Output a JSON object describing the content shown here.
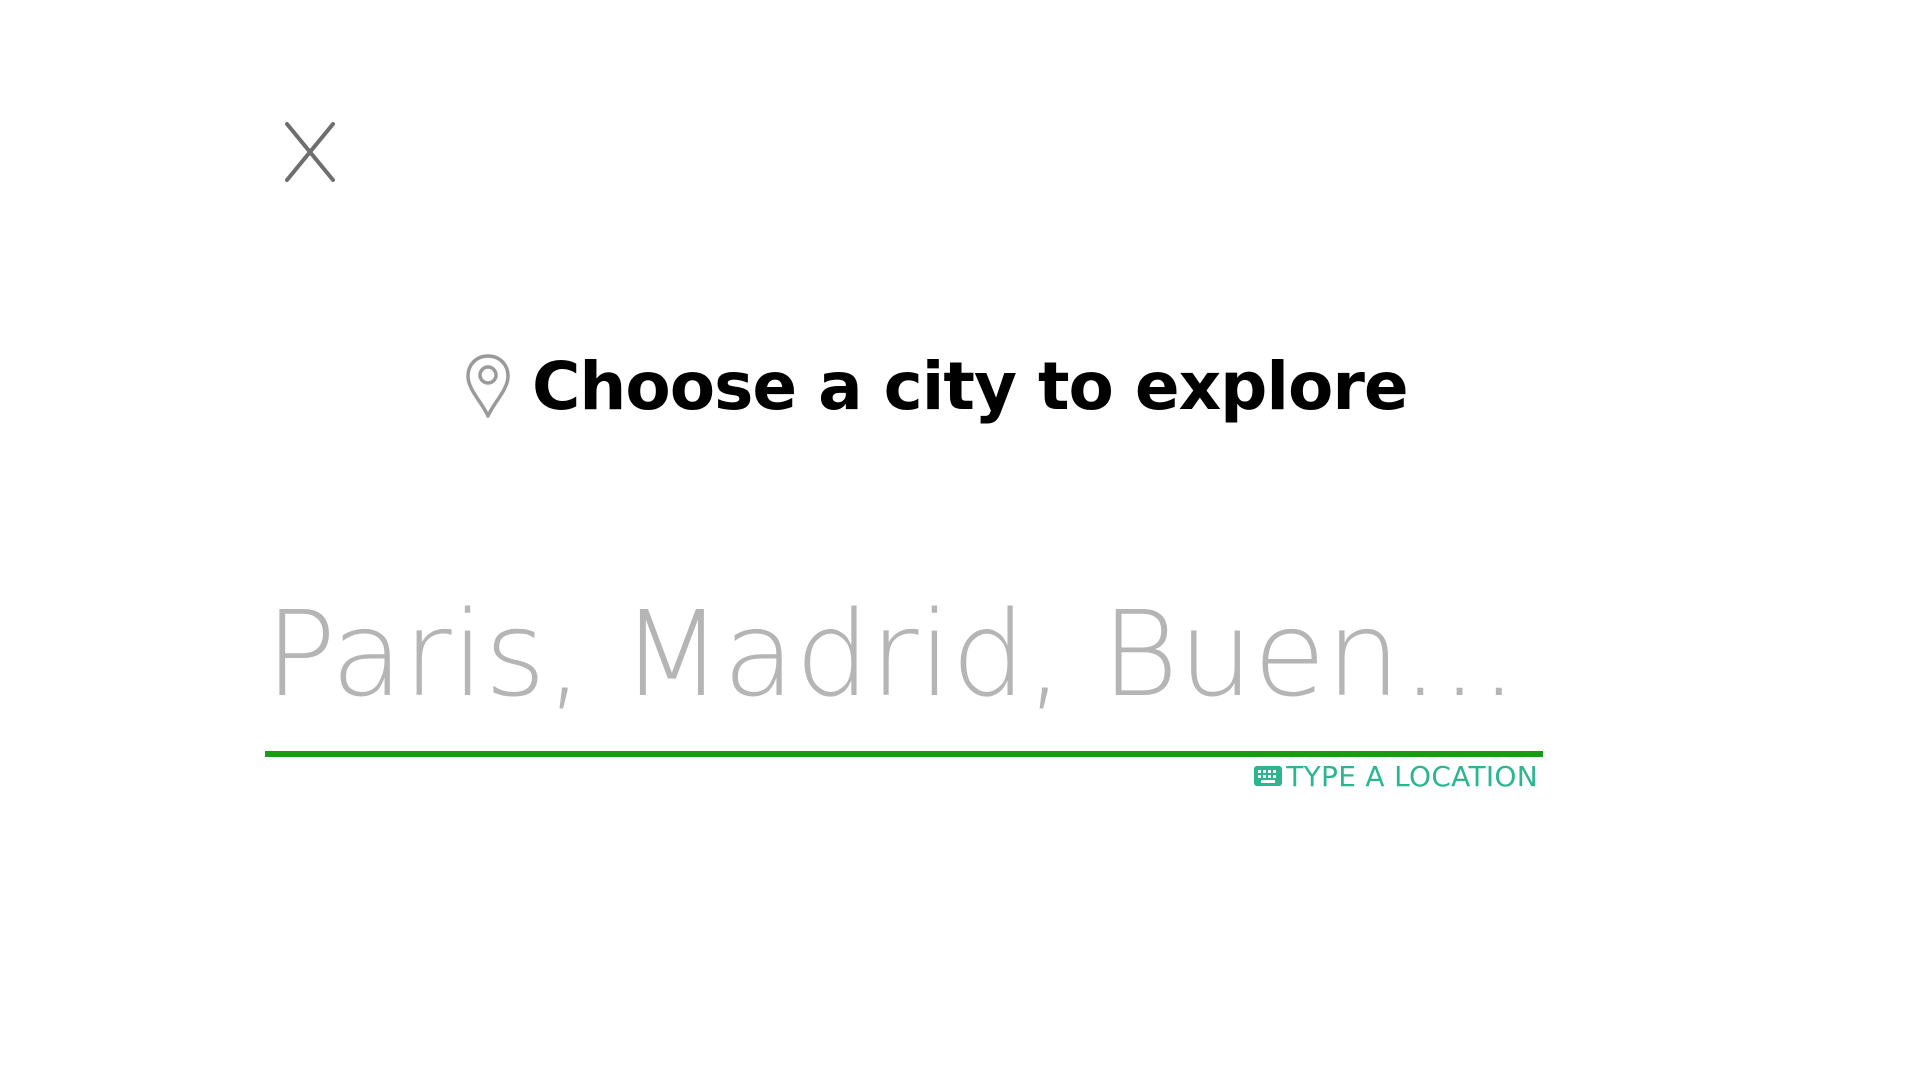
{
  "dialog": {
    "title": "Choose a city to explore",
    "close_icon": "close-icon",
    "title_icon": "map-pin-icon"
  },
  "search": {
    "placeholder": "Paris, Madrid, Buen…",
    "value": "",
    "hint_label": "TYPE A LOCATION",
    "hint_icon": "keyboard-icon"
  },
  "colors": {
    "accent_underline": "#1a9a1a",
    "hint_text": "#2bb690",
    "placeholder_text": "#b5b5b5",
    "title_text": "#000000"
  }
}
